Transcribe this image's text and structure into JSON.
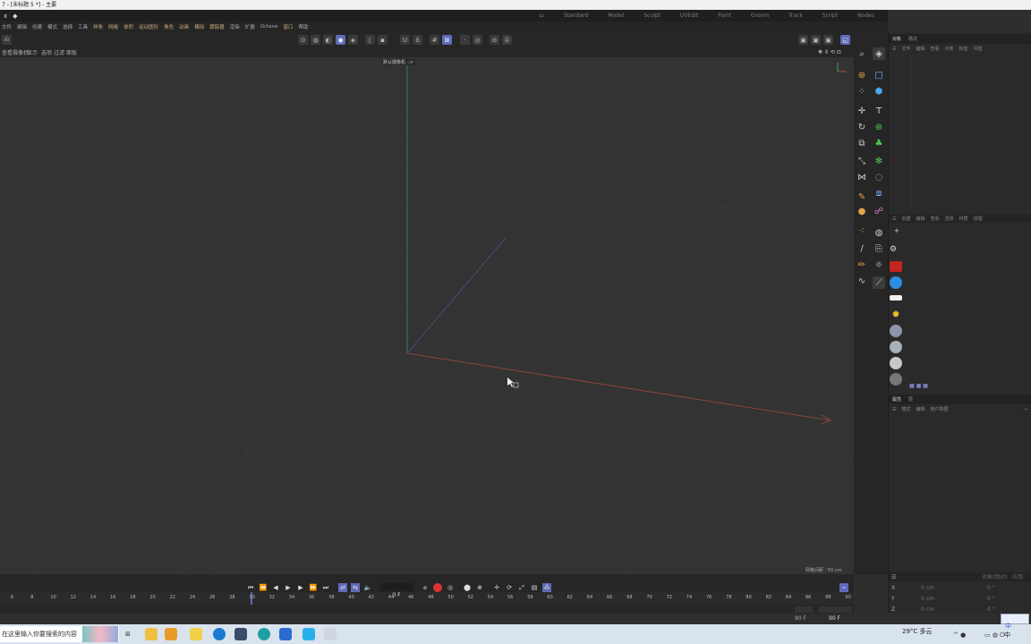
{
  "window": {
    "title": "7 - [未标题 5 *] - 主要"
  },
  "menubar": {
    "left_icons": [
      "x",
      "◆"
    ],
    "layout_tabs": [
      "Standard",
      "Model",
      "Sculpt",
      "UVEdit",
      "Paint",
      "Groom",
      "Track",
      "Script",
      "Nodes"
    ],
    "active_layout": "Standard"
  },
  "menus": [
    "文件",
    "编辑",
    "创建",
    "模式",
    "选择",
    "工具",
    "样条",
    "网格",
    "体积",
    "运动图形",
    "角色",
    "动画",
    "模拟",
    "跟踪器",
    "渲染",
    "扩展",
    "Octane",
    "窗口",
    "帮助"
  ],
  "viewbar": {
    "items": [
      "查看",
      "摄像机",
      "显示",
      "选项",
      "过滤",
      "面板"
    ]
  },
  "viewport": {
    "camera_label": "默认摄像机 ·:>",
    "grid_spacing": "网格间距 : 50 cm"
  },
  "object_panel": {
    "tabs": [
      "对象",
      "场次"
    ],
    "menu": [
      "文件",
      "编辑",
      "查看",
      "对象",
      "标签",
      "书签"
    ]
  },
  "content_panel": {
    "tabs": [
      "创建",
      "编辑",
      "查看",
      "选择",
      "材质",
      "纹理"
    ]
  },
  "attributes_panel": {
    "tabs": [
      "属性",
      "层"
    ],
    "menu": [
      "模式",
      "编辑",
      "用户数据"
    ]
  },
  "timeline": {
    "current_frame": "0 F",
    "ticks": [
      "6",
      "8",
      "10",
      "12",
      "14",
      "16",
      "18",
      "20",
      "22",
      "24",
      "26",
      "28",
      "30",
      "32",
      "34",
      "36",
      "38",
      "40",
      "42",
      "44",
      "46",
      "48",
      "50",
      "52",
      "54",
      "56",
      "58",
      "60",
      "62",
      "64",
      "66",
      "68",
      "70",
      "72",
      "74",
      "76",
      "78",
      "80",
      "82",
      "84",
      "86",
      "88",
      "90"
    ],
    "end_frame_a": "90 F",
    "end_frame_b": "90 F"
  },
  "coords": {
    "header": [
      "",
      "对象(相对)",
      "应用"
    ],
    "rows": [
      {
        "axis": "X",
        "pos": "0 cm",
        "rot": "0 °"
      },
      {
        "axis": "Y",
        "pos": "0 cm",
        "rot": "0 °"
      },
      {
        "axis": "Z",
        "pos": "0 cm",
        "rot": "0 °"
      }
    ]
  },
  "taskbar": {
    "search_placeholder": "在这里输入你要搜索的内容",
    "weather": "29°C 多云",
    "ime": "中"
  },
  "colors": {
    "accent": "#5d6ab8",
    "x_axis": "#9a4a3a",
    "y_axis": "#3e8a6a",
    "z_axis": "#3e5a8a"
  }
}
